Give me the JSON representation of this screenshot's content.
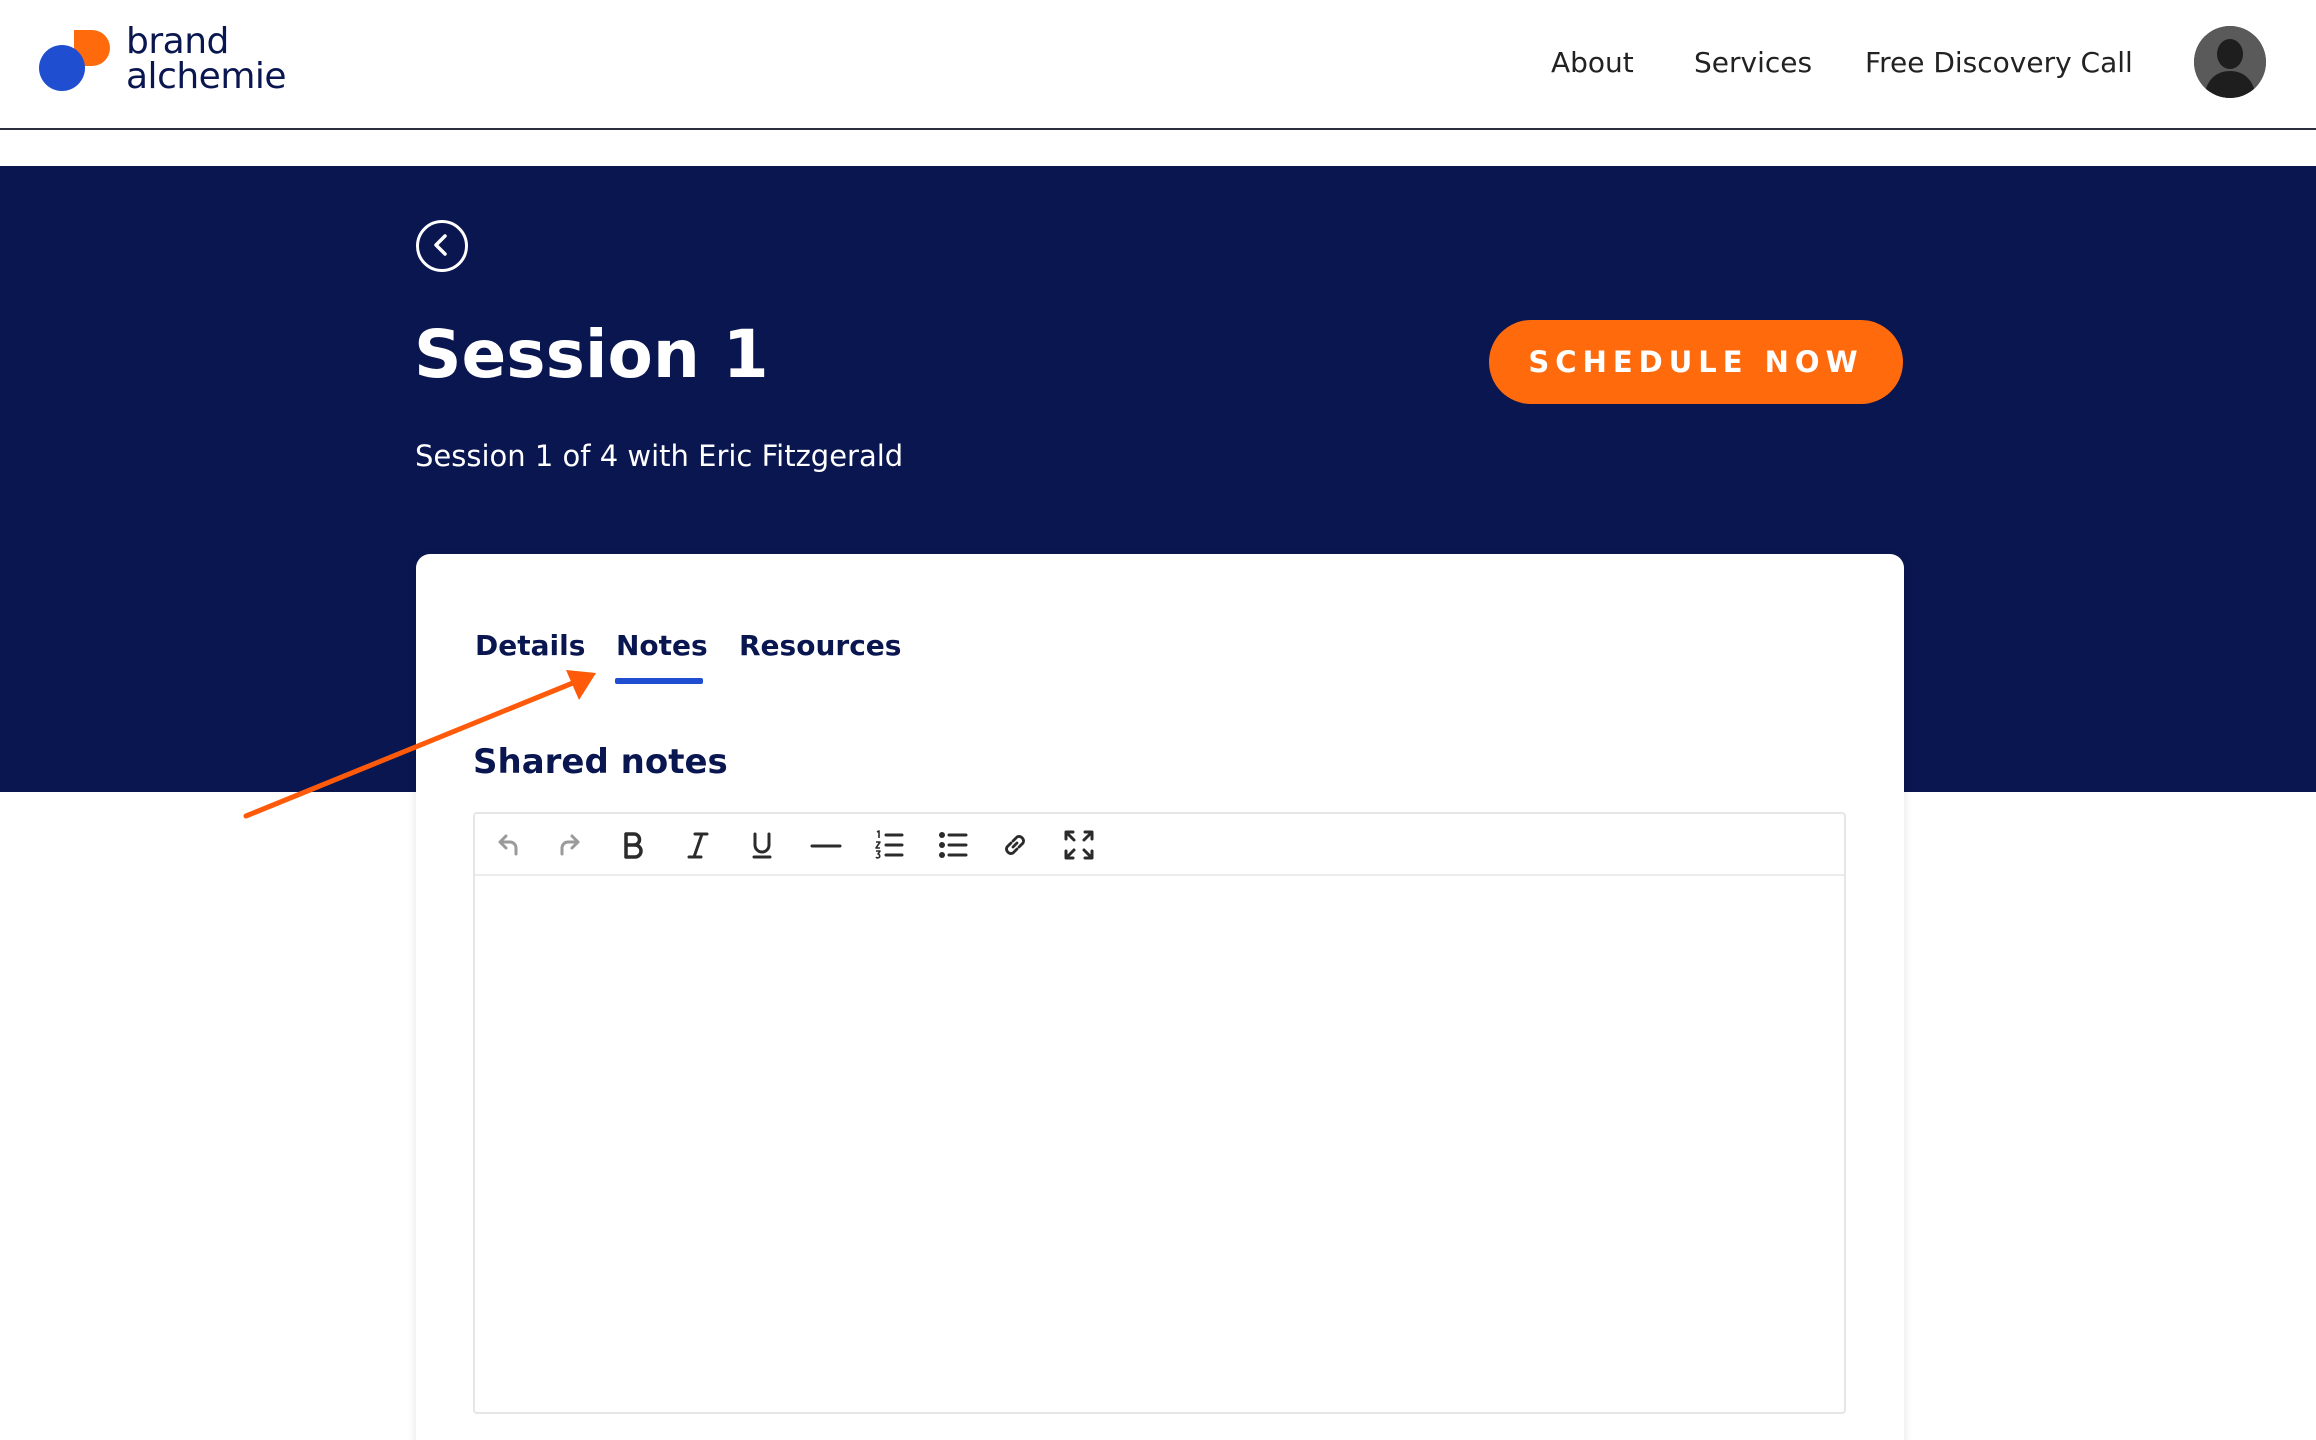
{
  "header": {
    "logo": {
      "line1": "brand",
      "line2": "alchemie"
    },
    "nav": {
      "about": "About",
      "services": "Services",
      "discovery_call": "Free Discovery Call"
    }
  },
  "hero": {
    "title": "Session 1",
    "subtitle": "Session 1 of 4 with Eric Fitzgerald",
    "schedule_label": "SCHEDULE NOW"
  },
  "tabs": {
    "details": "Details",
    "notes": "Notes",
    "resources": "Resources",
    "active": "Notes"
  },
  "notes": {
    "section_title": "Shared notes",
    "toolbar": [
      "undo-icon",
      "redo-icon",
      "bold-icon",
      "italic-icon",
      "underline-icon",
      "horizontal-rule-icon",
      "numbered-list-icon",
      "bulleted-list-icon",
      "link-icon",
      "fullscreen-icon"
    ],
    "content": ""
  },
  "colors": {
    "navy": "#0a1650",
    "orange": "#ff6a0d",
    "blue": "#1f4fd0",
    "white": "#ffffff"
  }
}
